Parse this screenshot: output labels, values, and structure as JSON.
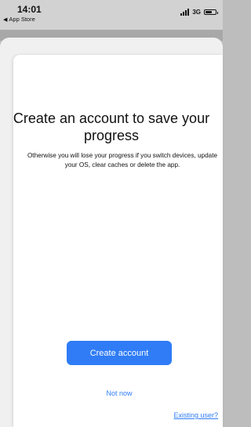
{
  "status_bar": {
    "time": "14:01",
    "back_app": "App Store",
    "network": "3G"
  },
  "onboarding": {
    "title": "Create an account to save your progress",
    "subtitle": "Otherwise you will lose your progress if you switch devices, update your OS, clear caches or delete the app.",
    "primary_button": "Create account",
    "secondary_link": "Not now",
    "existing_user_link": "Existing user?"
  },
  "colors": {
    "accent": "#2f7cf6",
    "status_bar_bg": "#d2d2d2",
    "card_bg": "#ffffff"
  }
}
